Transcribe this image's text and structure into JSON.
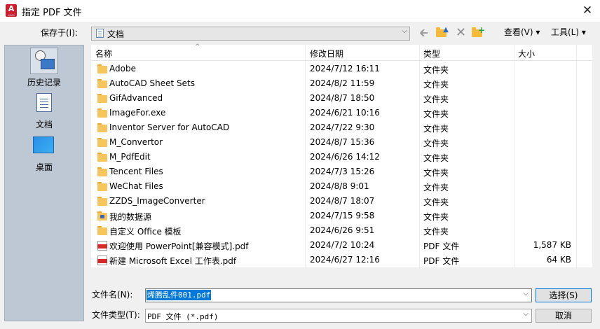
{
  "window": {
    "title": "指定 PDF 文件",
    "close": "✕",
    "app_icon_text": "A"
  },
  "toolbar": {
    "save_in_label": "保存于(I):",
    "path_value": "文档",
    "view_menu": "查看(V) ▾",
    "tools_menu": "工具(L) ▾"
  },
  "places": [
    {
      "label": "历史记录",
      "icon": "history-icon"
    },
    {
      "label": "文档",
      "icon": "documents-icon"
    },
    {
      "label": "桌面",
      "icon": "desktop-icon"
    }
  ],
  "columns": {
    "name": "名称",
    "date": "修改日期",
    "type": "类型",
    "size": "大小"
  },
  "files": [
    {
      "name": "Adobe",
      "date": "2024/7/12 16:11",
      "type": "文件夹",
      "size": "",
      "icon": "folder"
    },
    {
      "name": "AutoCAD Sheet Sets",
      "date": "2024/8/2 11:59",
      "type": "文件夹",
      "size": "",
      "icon": "folder"
    },
    {
      "name": "GifAdvanced",
      "date": "2024/8/7 18:50",
      "type": "文件夹",
      "size": "",
      "icon": "folder"
    },
    {
      "name": "ImageFor.exe",
      "date": "2024/6/21 10:16",
      "type": "文件夹",
      "size": "",
      "icon": "folder"
    },
    {
      "name": "Inventor Server for AutoCAD",
      "date": "2024/7/22 9:30",
      "type": "文件夹",
      "size": "",
      "icon": "folder"
    },
    {
      "name": "M_Convertor",
      "date": "2024/8/7 15:36",
      "type": "文件夹",
      "size": "",
      "icon": "folder"
    },
    {
      "name": "M_PdfEdit",
      "date": "2024/6/26 14:12",
      "type": "文件夹",
      "size": "",
      "icon": "folder"
    },
    {
      "name": "Tencent Files",
      "date": "2024/7/3 15:26",
      "type": "文件夹",
      "size": "",
      "icon": "folder"
    },
    {
      "name": "WeChat Files",
      "date": "2024/8/8 9:01",
      "type": "文件夹",
      "size": "",
      "icon": "folder"
    },
    {
      "name": "ZZDS_ImageConverter",
      "date": "2024/8/7 18:07",
      "type": "文件夹",
      "size": "",
      "icon": "folder"
    },
    {
      "name": "我的数据源",
      "date": "2024/7/15 9:58",
      "type": "文件夹",
      "size": "",
      "icon": "special-folder"
    },
    {
      "name": "自定义 Office 模板",
      "date": "2024/6/26 9:51",
      "type": "文件夹",
      "size": "",
      "icon": "folder"
    },
    {
      "name": "欢迎使用 PowerPoint[兼容模式].pdf",
      "date": "2024/7/2 10:24",
      "type": "PDF 文件",
      "size": "1,587 KB",
      "icon": "pdf"
    },
    {
      "name": "新建 Microsoft Excel 工作表.pdf",
      "date": "2024/6/27 12:16",
      "type": "PDF 文件",
      "size": "64 KB",
      "icon": "pdf"
    }
  ],
  "footer": {
    "filename_label": "文件名(N):",
    "filename_value": "烯腾乱件001.pdf",
    "filetype_label": "文件类型(T):",
    "filetype_value": "PDF 文件 (*.pdf)",
    "select_button": "选择(S)",
    "cancel_button": "取消"
  },
  "colors": {
    "accent": "#0078d7",
    "places_bg": "#bec8d4",
    "folder": "#f7c55d",
    "pdf": "#d42a2a"
  }
}
